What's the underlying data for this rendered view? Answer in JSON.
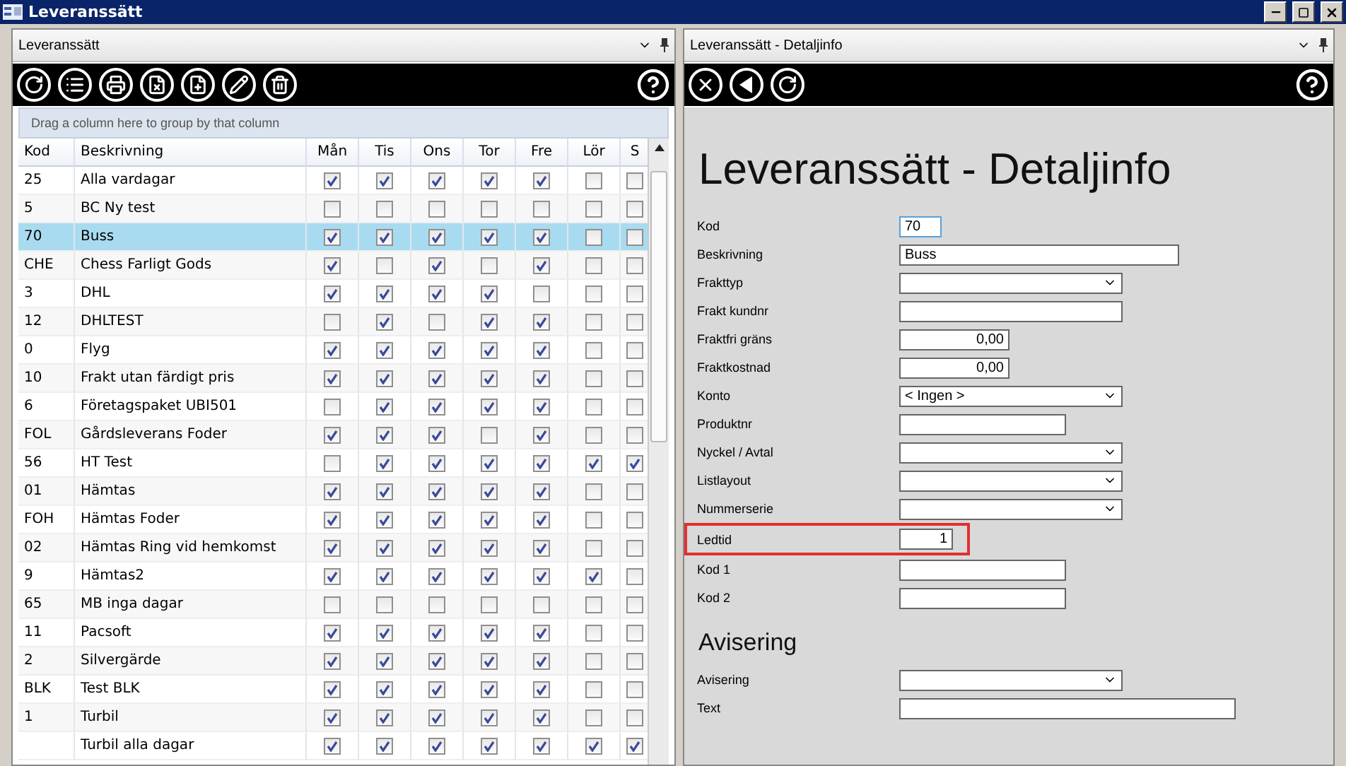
{
  "window": {
    "title": "Leveranssätt"
  },
  "list_pane": {
    "title": "Leveranssätt",
    "group_hint": "Drag a column here to group by that column",
    "toolbar": [
      {
        "kind": "refresh"
      },
      {
        "kind": "list-settings"
      },
      {
        "kind": "print"
      },
      {
        "kind": "export"
      },
      {
        "kind": "new"
      },
      {
        "kind": "edit"
      },
      {
        "kind": "delete"
      },
      {
        "kind": "help"
      }
    ],
    "columns": [
      "Kod",
      "Beskrivning",
      "Mån",
      "Tis",
      "Ons",
      "Tor",
      "Fre",
      "Lör",
      "S"
    ],
    "rows": [
      {
        "code": "25",
        "description": "Alla vardagar",
        "selected": false,
        "days": [
          true,
          true,
          true,
          true,
          true,
          false,
          false
        ]
      },
      {
        "code": "5",
        "description": "BC Ny test",
        "selected": false,
        "days": [
          false,
          false,
          false,
          false,
          false,
          false,
          false
        ]
      },
      {
        "code": "70",
        "description": "Buss",
        "selected": true,
        "days": [
          true,
          true,
          true,
          true,
          true,
          false,
          false
        ]
      },
      {
        "code": "CHE",
        "description": "Chess Farligt Gods",
        "selected": false,
        "days": [
          true,
          false,
          true,
          false,
          true,
          false,
          false
        ]
      },
      {
        "code": "3",
        "description": "DHL",
        "selected": false,
        "days": [
          true,
          true,
          true,
          true,
          false,
          false,
          false
        ]
      },
      {
        "code": "12",
        "description": "DHLTEST",
        "selected": false,
        "days": [
          false,
          true,
          false,
          true,
          true,
          false,
          false
        ]
      },
      {
        "code": "0",
        "description": "Flyg",
        "selected": false,
        "days": [
          true,
          true,
          true,
          true,
          true,
          false,
          false
        ]
      },
      {
        "code": "10",
        "description": "Frakt utan färdigt pris",
        "selected": false,
        "days": [
          true,
          true,
          true,
          true,
          true,
          false,
          false
        ]
      },
      {
        "code": "6",
        "description": "Företagspaket UBI501",
        "selected": false,
        "days": [
          false,
          true,
          true,
          true,
          true,
          false,
          false
        ]
      },
      {
        "code": "FOL",
        "description": "Gårdsleverans Foder",
        "selected": false,
        "days": [
          true,
          true,
          true,
          false,
          true,
          false,
          false
        ]
      },
      {
        "code": "56",
        "description": "HT Test",
        "selected": false,
        "days": [
          false,
          true,
          true,
          true,
          true,
          true,
          true
        ]
      },
      {
        "code": "01",
        "description": "Hämtas",
        "selected": false,
        "days": [
          true,
          true,
          true,
          true,
          true,
          false,
          false
        ]
      },
      {
        "code": "FOH",
        "description": "Hämtas Foder",
        "selected": false,
        "days": [
          true,
          true,
          true,
          true,
          true,
          false,
          false
        ]
      },
      {
        "code": "02",
        "description": "Hämtas Ring vid hemkomst",
        "selected": false,
        "days": [
          true,
          true,
          true,
          true,
          true,
          false,
          false
        ]
      },
      {
        "code": "9",
        "description": "Hämtas2",
        "selected": false,
        "days": [
          true,
          true,
          true,
          true,
          true,
          true,
          false
        ]
      },
      {
        "code": "65",
        "description": "MB inga dagar",
        "selected": false,
        "days": [
          false,
          false,
          false,
          false,
          false,
          false,
          false
        ]
      },
      {
        "code": "11",
        "description": "Pacsoft",
        "selected": false,
        "days": [
          true,
          true,
          true,
          true,
          true,
          false,
          false
        ]
      },
      {
        "code": "2",
        "description": "Silvergärde",
        "selected": false,
        "days": [
          true,
          true,
          true,
          true,
          true,
          false,
          false
        ]
      },
      {
        "code": "BLK",
        "description": "Test BLK",
        "selected": false,
        "days": [
          true,
          true,
          true,
          true,
          true,
          false,
          false
        ]
      },
      {
        "code": "1",
        "description": "Turbil",
        "selected": false,
        "days": [
          true,
          true,
          true,
          true,
          true,
          false,
          false
        ]
      },
      {
        "code": "",
        "description": "Turbil alla dagar",
        "selected": false,
        "days": [
          true,
          true,
          true,
          true,
          true,
          true,
          true
        ]
      }
    ]
  },
  "detail_pane": {
    "title": "Leveranssätt - Detaljinfo",
    "toolbar": [
      {
        "kind": "close"
      },
      {
        "kind": "back"
      },
      {
        "kind": "refresh"
      },
      {
        "kind": "help"
      }
    ],
    "heading": "Leveranssätt - Detaljinfo",
    "sections": [
      {
        "fields": [
          {
            "label": "Kod",
            "kind": "input",
            "value": "70",
            "focused": true
          },
          {
            "label": "Beskrivning",
            "kind": "input",
            "value": "Buss"
          },
          {
            "label": "Frakttyp",
            "kind": "dropdown"
          },
          {
            "label": "Frakt kundnr",
            "kind": "input"
          },
          {
            "label": "Fraktfri gräns",
            "kind": "amount",
            "value": "0,00"
          },
          {
            "label": "Fraktkostnad",
            "kind": "amount",
            "value": "0,00"
          },
          {
            "label": "Konto",
            "kind": "dropdown",
            "value": "< Ingen >"
          },
          {
            "label": "Produktnr",
            "kind": "input"
          },
          {
            "label": "Nyckel / Avtal",
            "kind": "dropdown"
          },
          {
            "label": "Listlayout",
            "kind": "dropdown"
          },
          {
            "label": "Nummerserie",
            "kind": "dropdown"
          },
          {
            "label": "Ledtid",
            "kind": "amount",
            "value": "1",
            "highlighted": true
          },
          {
            "label": "Kod 1",
            "kind": "input"
          },
          {
            "label": "Kod 2",
            "kind": "input"
          }
        ]
      },
      {
        "title": "Avisering",
        "fields": [
          {
            "label": "Avisering",
            "kind": "dropdown"
          },
          {
            "label": "Text",
            "kind": "input"
          }
        ]
      }
    ]
  }
}
